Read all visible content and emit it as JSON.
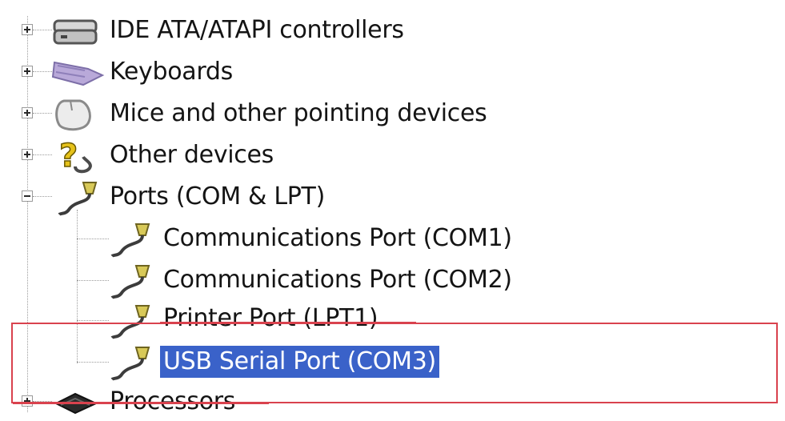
{
  "tree": {
    "items": [
      {
        "label": "IDE ATA/ATAPI controllers",
        "icon": "ide-controller-icon",
        "expanded": false
      },
      {
        "label": "Keyboards",
        "icon": "keyboard-icon",
        "expanded": false
      },
      {
        "label": "Mice and other pointing devices",
        "icon": "mouse-icon",
        "expanded": false
      },
      {
        "label": "Other devices",
        "icon": "question-mark-icon",
        "expanded": false
      },
      {
        "label": "Ports (COM & LPT)",
        "icon": "port-connector-icon",
        "expanded": true,
        "children": [
          {
            "label": "Communications Port (COM1)",
            "icon": "port-connector-icon"
          },
          {
            "label": "Communications Port (COM2)",
            "icon": "port-connector-icon"
          },
          {
            "label": "Printer Port (LPT1)",
            "icon": "port-connector-icon"
          },
          {
            "label": "USB Serial Port (COM3)",
            "icon": "port-connector-icon",
            "selected": true
          }
        ]
      },
      {
        "label": "Processors",
        "icon": "processor-icon",
        "expanded": false
      }
    ]
  },
  "colors": {
    "selection": "#3a62c9",
    "annotation": "#d9424e",
    "port_icon": "#c9b43a",
    "question_icon": "#e6c21a"
  }
}
